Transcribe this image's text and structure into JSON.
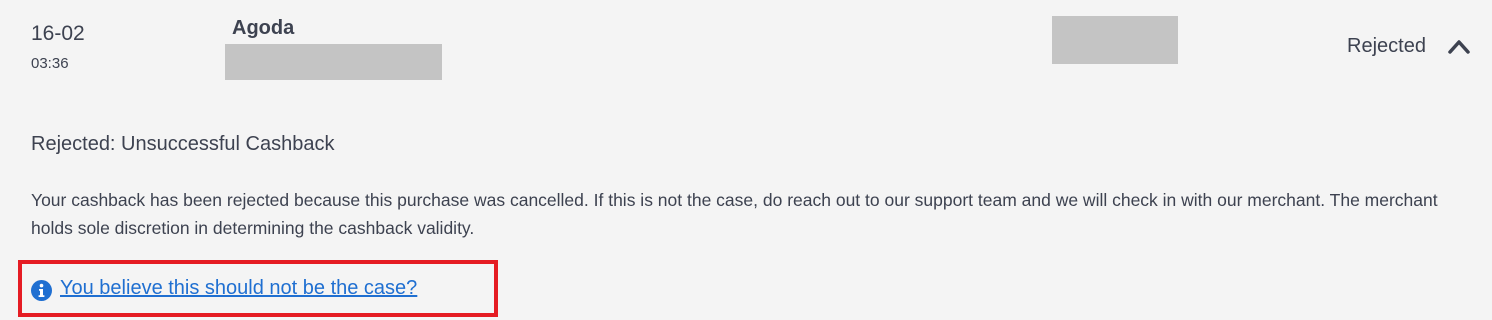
{
  "transaction": {
    "date": "16-02",
    "time": "03:36",
    "merchant": "Agoda",
    "status": "Rejected"
  },
  "details": {
    "title": "Rejected: Unsuccessful Cashback",
    "body": "Your cashback has been rejected because this purchase was cancelled. If this is not the case, do reach out to our support team and we will check in with our merchant. The merchant holds sole discretion in determining the cashback validity.",
    "appeal_link": "You believe this should not be the case?"
  },
  "icons": {
    "expand": "chevron-up-icon",
    "info": "info-icon"
  },
  "colors": {
    "background": "#f4f4f4",
    "text": "#3d4250",
    "link": "#1f6fd1",
    "highlight": "#e51c23",
    "redaction": "#c4c4c4"
  }
}
